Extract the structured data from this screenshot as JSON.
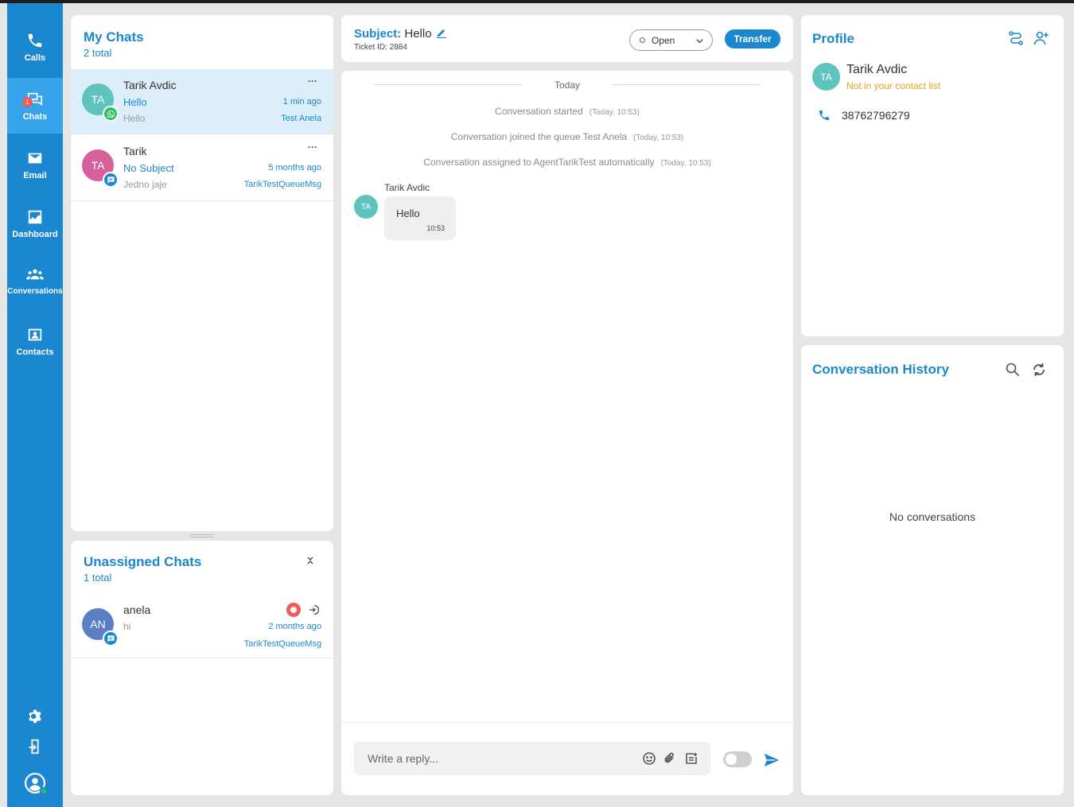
{
  "nav": {
    "calls": "Calls",
    "chats": "Chats",
    "chats_badge": "1",
    "email": "Email",
    "dashboard": "Dashboard",
    "conversations": "Conversations",
    "contacts": "Contacts"
  },
  "my_chats": {
    "title": "My Chats",
    "total": "2 total",
    "items": [
      {
        "initials": "TA",
        "name": "Tarik Avdic",
        "subject": "Hello",
        "last": "Hello",
        "time": "1 min ago",
        "queue": "Test Anela",
        "channel": "whatsapp",
        "avatar_color": "#5fc4bd"
      },
      {
        "initials": "TA",
        "name": "Tarik",
        "subject": "No Subject",
        "last": "Jedno jaje",
        "time": "5 months ago",
        "queue": "TarikTestQueueMsg",
        "channel": "chat",
        "avatar_color": "#d6609b"
      }
    ],
    "more": "···"
  },
  "unassigned": {
    "title": "Unassigned Chats",
    "total": "1 total",
    "items": [
      {
        "initials": "AN",
        "name": "anela",
        "last": "hi",
        "time": "2 months ago",
        "queue": "TarikTestQueueMsg",
        "channel": "chat",
        "avatar_color": "#5b7fc4"
      }
    ]
  },
  "conversation": {
    "subject_label": "Subject:",
    "subject": "Hello",
    "ticket": "Ticket ID: 2884",
    "status": "Open",
    "transfer": "Transfer",
    "day_divider": "Today",
    "system_messages": [
      {
        "text": "Conversation started",
        "time": "(Today, 10:53)"
      },
      {
        "text": "Conversation joined the queue Test Anela",
        "time": "(Today, 10:53)"
      },
      {
        "text": "Conversation assigned to AgentTarikTest automatically",
        "time": "(Today, 10:53)"
      }
    ],
    "message": {
      "sender": "Tarik Avdic",
      "initials": "TA",
      "text": "Hello",
      "time": "10:53"
    },
    "reply_placeholder": "Write a reply..."
  },
  "profile": {
    "title": "Profile",
    "initials": "TA",
    "name": "Tarik Avdic",
    "note": "Not in your contact list",
    "phone": "38762796279"
  },
  "history": {
    "title": "Conversation History",
    "empty": "No conversations"
  },
  "colors": {
    "primary": "#1a87d0",
    "sidebar_active": "#37a3eb",
    "whatsapp": "#25c35a",
    "alert": "#ef5b5b",
    "warning": "#e9a21a"
  }
}
